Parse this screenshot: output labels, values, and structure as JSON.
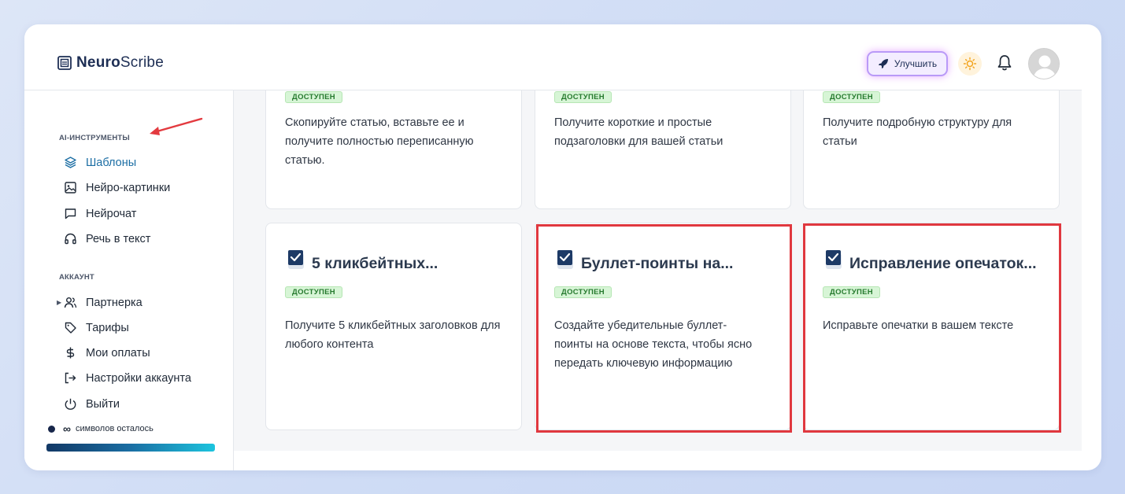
{
  "app": {
    "logo_bold": "Neuro",
    "logo_light": "Scribe"
  },
  "header": {
    "upgrade_label": "Улучшить"
  },
  "sidebar": {
    "section_tools": "AI-ИНСТРУМЕНТЫ",
    "tools": [
      {
        "label": "Шаблоны",
        "icon": "layers-icon",
        "active": true
      },
      {
        "label": "Нейро-картинки",
        "icon": "image-icon"
      },
      {
        "label": "Нейрочат",
        "icon": "chat-icon"
      },
      {
        "label": "Речь в текст",
        "icon": "headphones-icon"
      }
    ],
    "section_account": "АККАУНТ",
    "account": [
      {
        "label": "Партнерка",
        "icon": "users-icon"
      },
      {
        "label": "Тарифы",
        "icon": "tag-icon"
      },
      {
        "label": "Мои оплаты",
        "icon": "dollar-icon"
      },
      {
        "label": "Настройки аккаунта",
        "icon": "logout-arrow-icon"
      },
      {
        "label": "Выйти",
        "icon": "power-icon"
      }
    ],
    "credits_symbol": "∞",
    "credits_label": "символов осталось"
  },
  "cards_top": [
    {
      "badge": "ДОСТУПЕН",
      "desc": "Скопируйте статью, вставьте ее и получите полностью переписанную статью."
    },
    {
      "badge": "ДОСТУПЕН",
      "desc": "Получите короткие и простые подзаголовки для вашей статьи"
    },
    {
      "badge": "ДОСТУПЕН",
      "desc": "Получите подробную структуру для статьи"
    }
  ],
  "cards_bottom": [
    {
      "title": "5 кликбейтных...",
      "badge": "ДОСТУПЕН",
      "desc": "Получите 5 кликбейтных заголовков для любого контента"
    },
    {
      "title": "Буллет-поинты на...",
      "badge": "ДОСТУПЕН",
      "desc": "Создайте убедительные буллет-поинты на основе текста, чтобы ясно передать ключевую информацию"
    },
    {
      "title": "Исправление опечаток...",
      "badge": "ДОСТУПЕН",
      "desc": "Исправьте опечатки в вашем тексте"
    }
  ],
  "colors": {
    "accent": "#1c6ea4",
    "highlight": "#e0383f",
    "badge_bg": "#d7f5d6",
    "badge_text": "#267a2e"
  }
}
